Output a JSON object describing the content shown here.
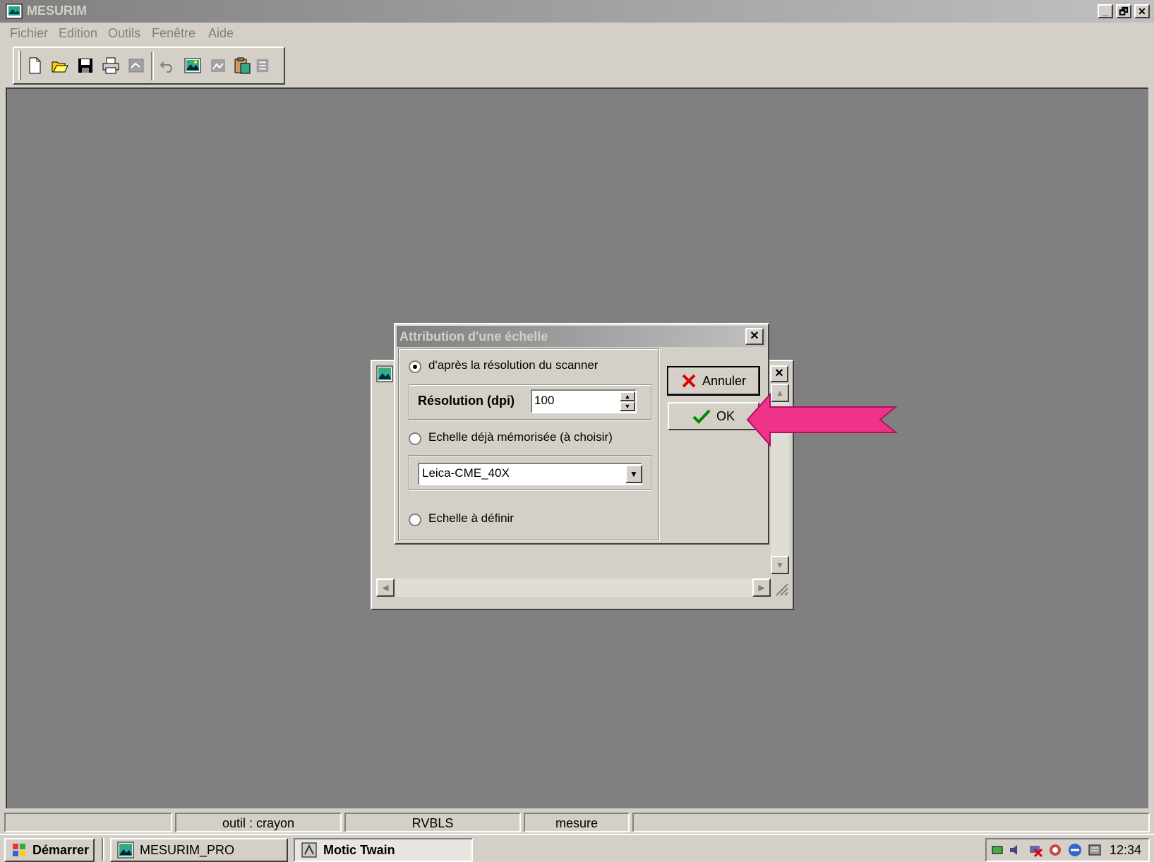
{
  "app": {
    "title": "MESURIM",
    "min_label": "_",
    "restore_label": "🗗",
    "close_label": "✕"
  },
  "menu": {
    "items": [
      {
        "label": "Fichier"
      },
      {
        "label": "Edition"
      },
      {
        "label": "Outils"
      },
      {
        "label": "Fenêtre"
      },
      {
        "label": "Aide"
      }
    ]
  },
  "toolbar": {
    "buttons": [
      "new-file",
      "open-folder",
      "save",
      "print",
      "disabled-tool",
      "undo",
      "image",
      "disabled-image",
      "paste",
      "disabled-extra"
    ]
  },
  "dialog": {
    "title": "Attribution d'une échelle",
    "close_label": "✕",
    "option_scanner": "d'après la résolution du scanner",
    "resolution_label": "Résolution (dpi)",
    "resolution_value": "100",
    "option_memorized": "Echelle déjà mémorisée (à choisir)",
    "scale_selected": "Leica-CME_40X",
    "option_define": "Echelle à définir",
    "cancel_label": "Annuler",
    "ok_label": "OK"
  },
  "statusbar": {
    "panels": [
      "",
      "outil : crayon",
      "RVBLS",
      "mesure",
      ""
    ]
  },
  "taskbar": {
    "start_label": "Démarrer",
    "tasks": [
      {
        "label": "MESURIM_PRO"
      },
      {
        "label": "Motic Twain"
      }
    ],
    "clock": "12:34"
  },
  "colors": {
    "arrow": "#ee3388",
    "face": "#d4d0c8",
    "workspace": "#808080"
  }
}
